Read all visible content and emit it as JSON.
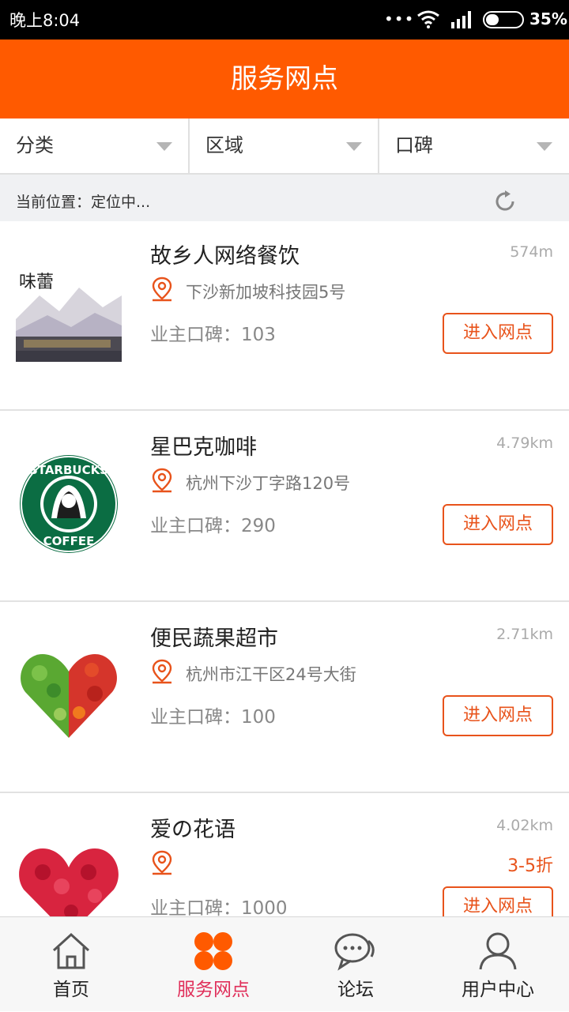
{
  "status": {
    "time": "晚上8:04",
    "dots": "•••",
    "battery_pct": "35%"
  },
  "header": {
    "title": "服务网点"
  },
  "filters": [
    {
      "label": "分类"
    },
    {
      "label": "区域"
    },
    {
      "label": "口碑"
    }
  ],
  "location": {
    "text": "当前位置：定位中..."
  },
  "shops": [
    {
      "name": "故乡人网络餐饮",
      "distance": "574m",
      "address": "下沙新加坡科技园5号",
      "rating": "业主口碑：103",
      "action": "进入网点",
      "discount": ""
    },
    {
      "name": "星巴克咖啡",
      "distance": "4.79km",
      "address": "杭州下沙丁字路120号",
      "rating": "业主口碑：290",
      "action": "进入网点",
      "discount": ""
    },
    {
      "name": "便民蔬果超市",
      "distance": "2.71km",
      "address": "杭州市江干区24号大街",
      "rating": "业主口碑：100",
      "action": "进入网点",
      "discount": ""
    },
    {
      "name": "爱の花语",
      "distance": "4.02km",
      "address": "",
      "rating": "业主口碑：1000",
      "action": "进入网点",
      "discount": "3-5折"
    }
  ],
  "tabs": [
    {
      "label": "首页",
      "icon": "home-icon"
    },
    {
      "label": "服务网点",
      "icon": "grid-icon"
    },
    {
      "label": "论坛",
      "icon": "chat-icon"
    },
    {
      "label": "用户中心",
      "icon": "user-icon"
    }
  ],
  "colors": {
    "accent": "#ff5a00",
    "button": "#e8531b",
    "active_tab": "#e02f5a"
  }
}
